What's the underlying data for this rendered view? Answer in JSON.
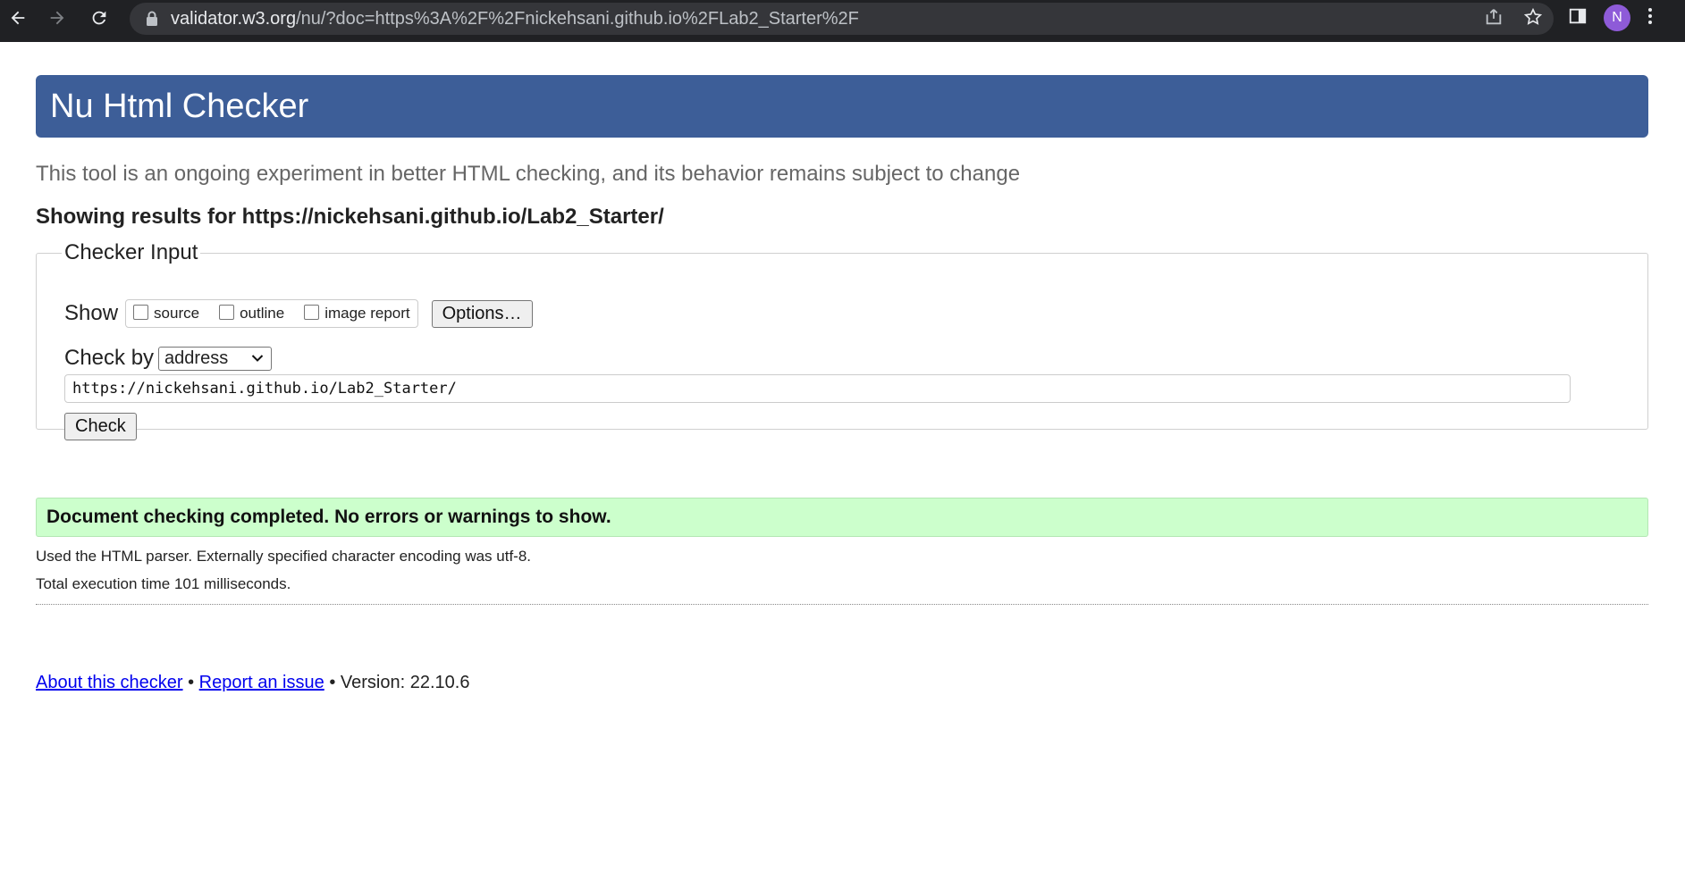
{
  "browser": {
    "url_host": "validator.w3.org",
    "url_path": "/nu/?doc=https%3A%2F%2Fnickehsani.github.io%2FLab2_Starter%2F",
    "profile_initial": "N",
    "icons": [
      "back-icon",
      "forward-icon",
      "reload-icon",
      "lock-icon",
      "share-icon",
      "star-icon",
      "side-panel-icon",
      "menu-icon"
    ]
  },
  "page": {
    "title": "Nu Html Checker",
    "subtitle": "This tool is an ongoing experiment in better HTML checking, and its behavior remains subject to change",
    "showing_results": "Showing results for https://nickehsani.github.io/Lab2_Starter/"
  },
  "checker_input": {
    "legend": "Checker Input",
    "show_label": "Show",
    "show_options": [
      {
        "label": "source",
        "checked": false
      },
      {
        "label": "outline",
        "checked": false
      },
      {
        "label": "image report",
        "checked": false
      }
    ],
    "options_button": "Options…",
    "check_by_label": "Check by",
    "check_by_value": "address",
    "url_value": "https://nickehsani.github.io/Lab2_Starter/",
    "check_button": "Check"
  },
  "results": {
    "success_message": "Document checking completed. No errors or warnings to show.",
    "parser_info": "Used the HTML parser. Externally specified character encoding was utf-8.",
    "execution_time": "Total execution time 101 milliseconds."
  },
  "footer": {
    "about_link": "About this checker",
    "separator": "•",
    "report_link": "Report an issue",
    "version": "Version: 22.10.6"
  },
  "colors": {
    "title_bar": "#3d5e98",
    "success_bg": "#ccffcc",
    "link": "#0000ee"
  }
}
